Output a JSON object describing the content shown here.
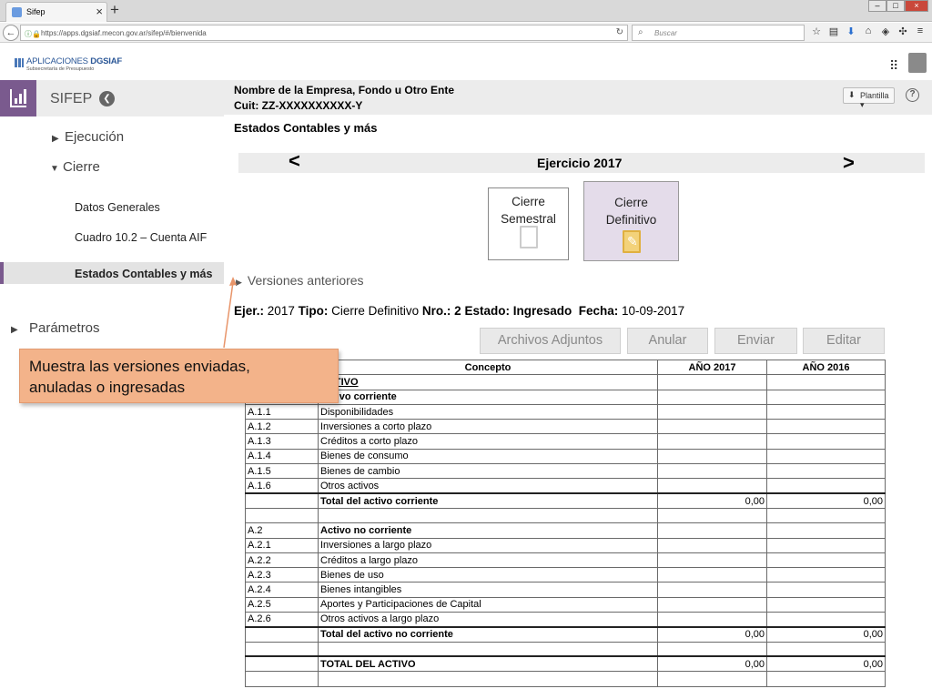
{
  "browser": {
    "tab_title": "Sifep",
    "tab_close": "×",
    "new_tab": "+",
    "url": "https://apps.dgsiaf.mecon.gov.ar/sifep/#/bienvenida",
    "search_placeholder": "Buscar"
  },
  "header": {
    "logo_prefix": "APLICACIONES",
    "logo_brand": "DGSIAF",
    "logo_subtitle": "Subsecretaría de Presupuesto"
  },
  "sidebar": {
    "title": "SIFEP",
    "back": "❮",
    "menu": [
      {
        "label": "Ejecución",
        "caret": "▶"
      },
      {
        "label": "Cierre",
        "caret": "▼"
      },
      {
        "label": "Parámetros",
        "caret": "▶"
      }
    ],
    "cierre_items": [
      "Datos Generales",
      "Cuadro 10.2  – Cuenta AIF"
    ],
    "active_item": "Estados Contables y más"
  },
  "info": {
    "empresa": "Nombre de la Empresa, Fondo u Otro Ente",
    "cuit": "Cuit: ZZ-XXXXXXXXXX-Y",
    "plantilla": "Plantilla ▾",
    "help": "?"
  },
  "page_title": "Estados Contables y más",
  "ejercicio": {
    "prev": "<",
    "label": "Ejercicio 2017",
    "next": ">"
  },
  "cards": [
    {
      "line1": "Cierre",
      "line2": "Semestral"
    },
    {
      "line1": "Cierre",
      "line2": "Definitivo"
    }
  ],
  "versiones_label": "Versiones anteriores",
  "meta": {
    "ejer_label": "Ejer.:",
    "ejer_value": "2017",
    "tipo_label": "Tipo:",
    "tipo_value": "Cierre Definitivo",
    "nro_label": "Nro.: 2",
    "estado_label": "Estado: Ingresado",
    "fecha_label": "Fecha:",
    "fecha_value": "10-09-2017"
  },
  "buttons": {
    "adjuntos": "Archivos Adjuntos",
    "anular": "Anular",
    "enviar": "Enviar",
    "editar": "Editar"
  },
  "table": {
    "headers": [
      "",
      "Concepto",
      "AÑO 2017",
      "AÑO 2016"
    ],
    "rows": [
      [
        "",
        "ACTIVO",
        "",
        ""
      ],
      [
        "",
        "Activo corriente",
        "",
        ""
      ],
      [
        "A.1.1",
        "Disponibilidades",
        "",
        ""
      ],
      [
        "A.1.2",
        "Inversiones a corto plazo",
        "",
        ""
      ],
      [
        "A.1.3",
        "Créditos a corto plazo",
        "",
        ""
      ],
      [
        "A.1.4",
        "Bienes de consumo",
        "",
        ""
      ],
      [
        "A.1.5",
        "Bienes de cambio",
        "",
        ""
      ],
      [
        "A.1.6",
        "Otros activos",
        "",
        ""
      ],
      [
        "",
        "Total del activo corriente",
        "0,00",
        "0,00"
      ],
      [
        "",
        "",
        "",
        ""
      ],
      [
        "A.2",
        "Activo no corriente",
        "",
        ""
      ],
      [
        "A.2.1",
        "Inversiones a largo plazo",
        "",
        ""
      ],
      [
        "A.2.2",
        "Créditos a largo plazo",
        "",
        ""
      ],
      [
        "A.2.3",
        "Bienes de uso",
        "",
        ""
      ],
      [
        "A.2.4",
        "Bienes intangibles",
        "",
        ""
      ],
      [
        "A.2.5",
        "Aportes y Participaciones de Capital",
        "",
        ""
      ],
      [
        "A.2.6",
        "Otros activos a largo plazo",
        "",
        ""
      ],
      [
        "",
        "Total del activo no corriente",
        "0,00",
        "0,00"
      ],
      [
        "",
        "",
        "",
        ""
      ],
      [
        "",
        "TOTAL DEL ACTIVO",
        "0,00",
        "0,00"
      ],
      [
        "",
        "",
        "",
        ""
      ]
    ]
  },
  "callout": {
    "line1": "Muestra las versiones enviadas,",
    "line2": "anuladas o ingresadas"
  },
  "colors": {
    "accent": "#7a5a8e",
    "callout": "#f3b38a",
    "selected_card": "#e4dcea"
  }
}
